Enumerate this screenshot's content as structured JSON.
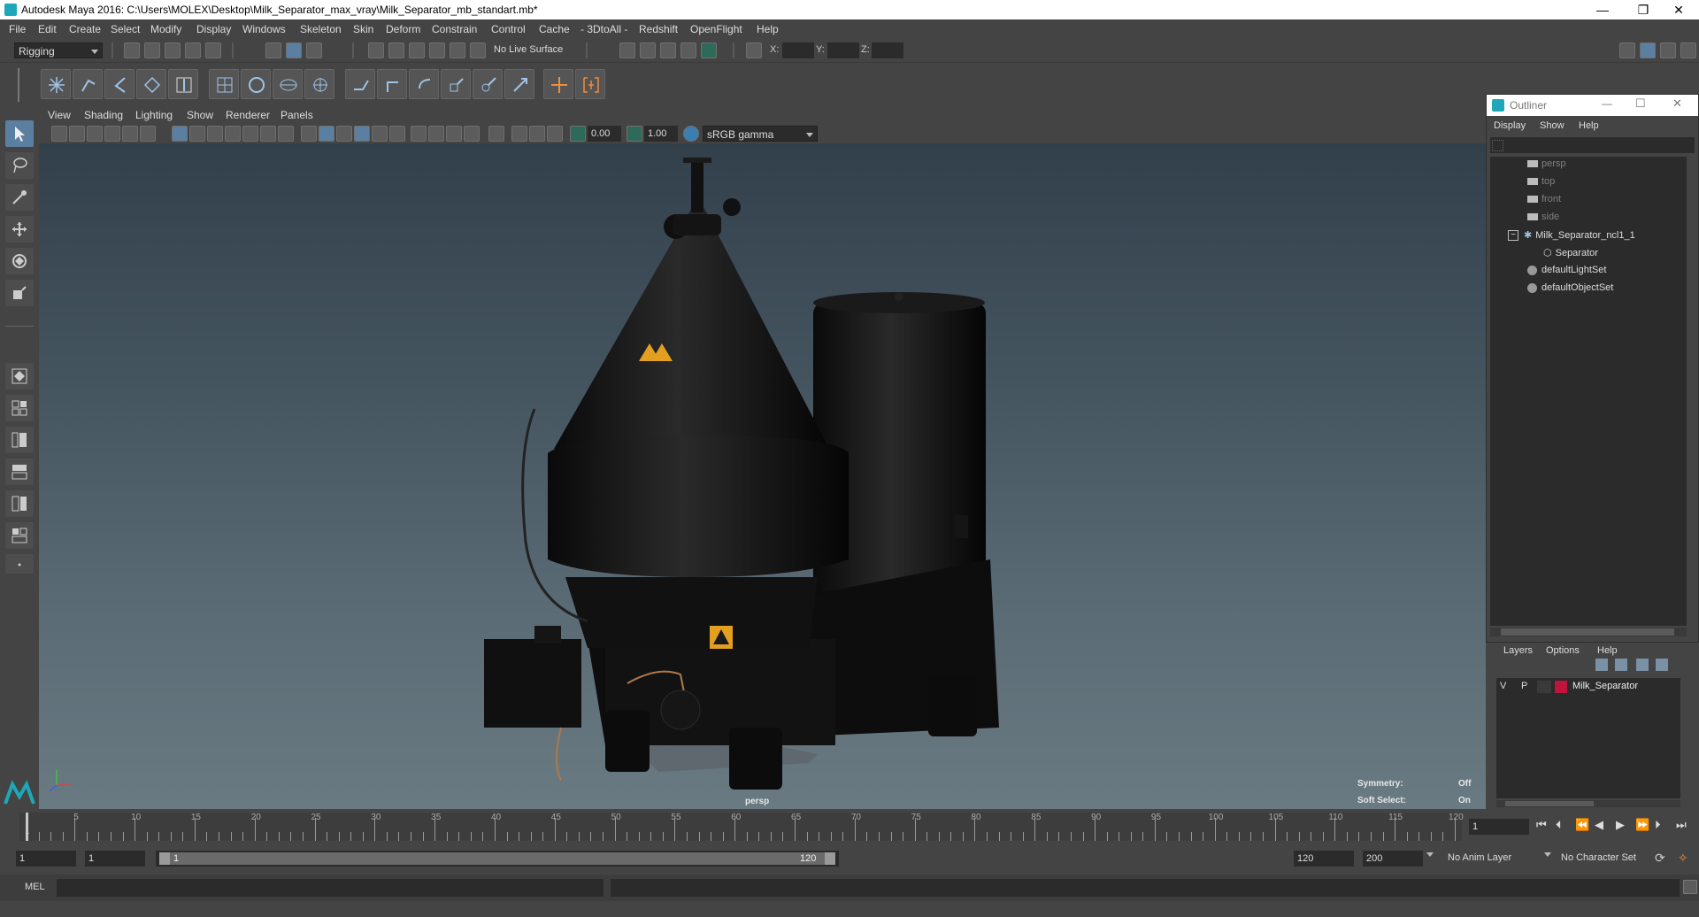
{
  "window": {
    "title": "Autodesk Maya 2016: C:\\Users\\MOLEX\\Desktop\\Milk_Separator_max_vray\\Milk_Separator_mb_standart.mb*",
    "minimize": "—",
    "restore": "❐",
    "close": "✕"
  },
  "menu": [
    "File",
    "Edit",
    "Create",
    "Select",
    "Modify",
    "Display",
    "Windows",
    "Skeleton",
    "Skin",
    "Deform",
    "Constrain",
    "Control",
    "Cache",
    "- 3DtoAll -",
    "Redshift",
    "OpenFlight",
    "Help"
  ],
  "status": {
    "mode": "Rigging",
    "live_surface": "No Live Surface",
    "x_label": "X:",
    "y_label": "Y:",
    "z_label": "Z:"
  },
  "viewport": {
    "menu": [
      "View",
      "Shading",
      "Lighting",
      "Show",
      "Renderer",
      "Panels"
    ],
    "exposure": "0.00",
    "gamma": "1.00",
    "color_space": "sRGB gamma",
    "camera": "persp",
    "symmetry_label": "Symmetry:",
    "symmetry_value": "Off",
    "soft_select_label": "Soft Select:",
    "soft_select_value": "On"
  },
  "outliner": {
    "title": "Outliner",
    "menu": [
      "Display",
      "Show",
      "Help"
    ],
    "items": [
      {
        "label": "persp",
        "type": "camera"
      },
      {
        "label": "top",
        "type": "camera"
      },
      {
        "label": "front",
        "type": "camera"
      },
      {
        "label": "side",
        "type": "camera"
      },
      {
        "label": "Milk_Separator_ncl1_1",
        "type": "group"
      },
      {
        "label": "Separator",
        "type": "mesh"
      },
      {
        "label": "defaultLightSet",
        "type": "set"
      },
      {
        "label": "defaultObjectSet",
        "type": "set"
      }
    ]
  },
  "layers": {
    "menu": [
      "Layers",
      "Options",
      "Help"
    ],
    "layer": {
      "v": "V",
      "p": "P",
      "name": "Milk_Separator",
      "color": "#c0143c"
    }
  },
  "timeline": {
    "ticks": [
      "5",
      "10",
      "15",
      "20",
      "25",
      "30",
      "35",
      "40",
      "45",
      "50",
      "55",
      "60",
      "65",
      "70",
      "75",
      "80",
      "85",
      "90",
      "95",
      "100",
      "105",
      "110",
      "115",
      "120"
    ],
    "start_tick": "1",
    "current_frame": "1"
  },
  "range": {
    "start": "1",
    "playback_start": "1",
    "slider_start": "1",
    "slider_end": "120",
    "playback_end": "120",
    "end": "200",
    "anim_layer": "No Anim Layer",
    "character_set": "No Character Set"
  },
  "command": {
    "lang": "MEL"
  }
}
